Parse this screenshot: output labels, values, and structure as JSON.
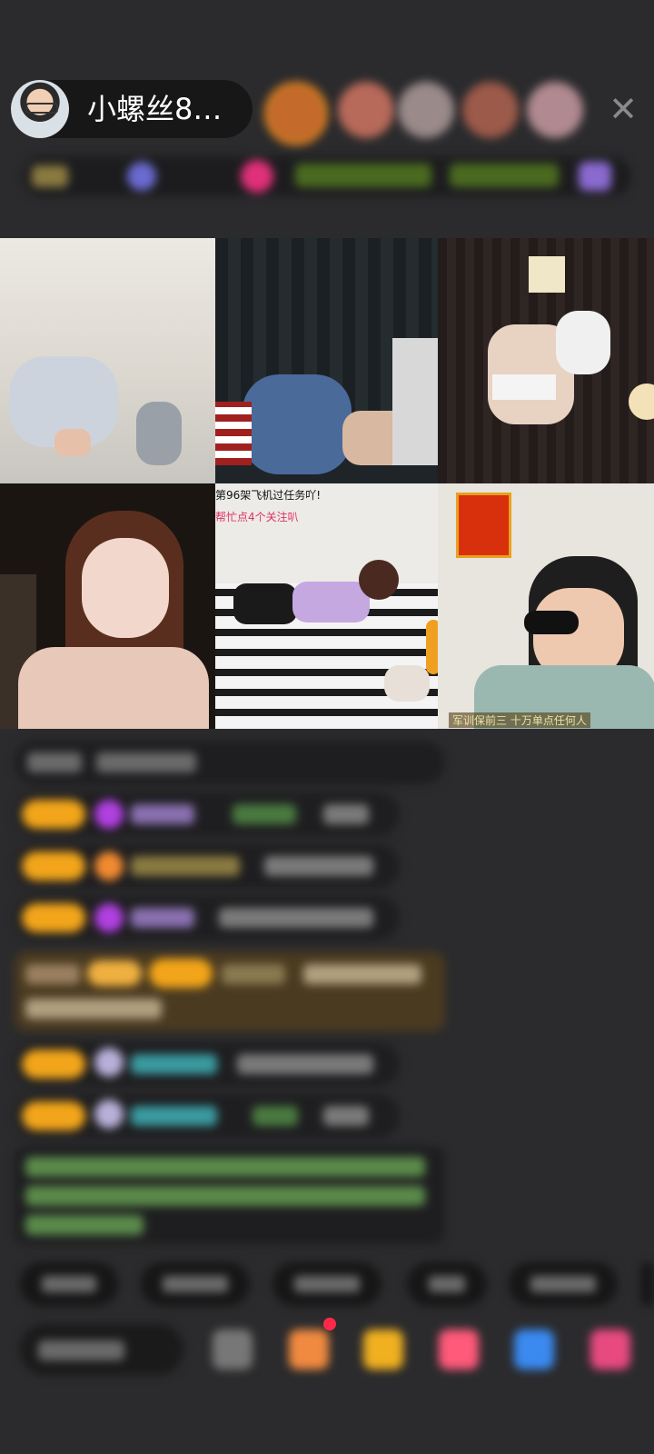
{
  "header": {
    "host_name": "小螺丝8…",
    "close_icon": "close-icon"
  },
  "tiles": {
    "tile5_caption_top": "第96架飞机过任务吖!",
    "tile5_caption_bottom": "帮忙点4个关注叭",
    "tile6_caption_bottom": "军训保前三  十万单点任何人"
  },
  "colors": {
    "background": "#2b2b2d",
    "badge": "#f2a51a",
    "chat_highlight": "#4a3a20",
    "notice_text": "#7fc36a"
  }
}
